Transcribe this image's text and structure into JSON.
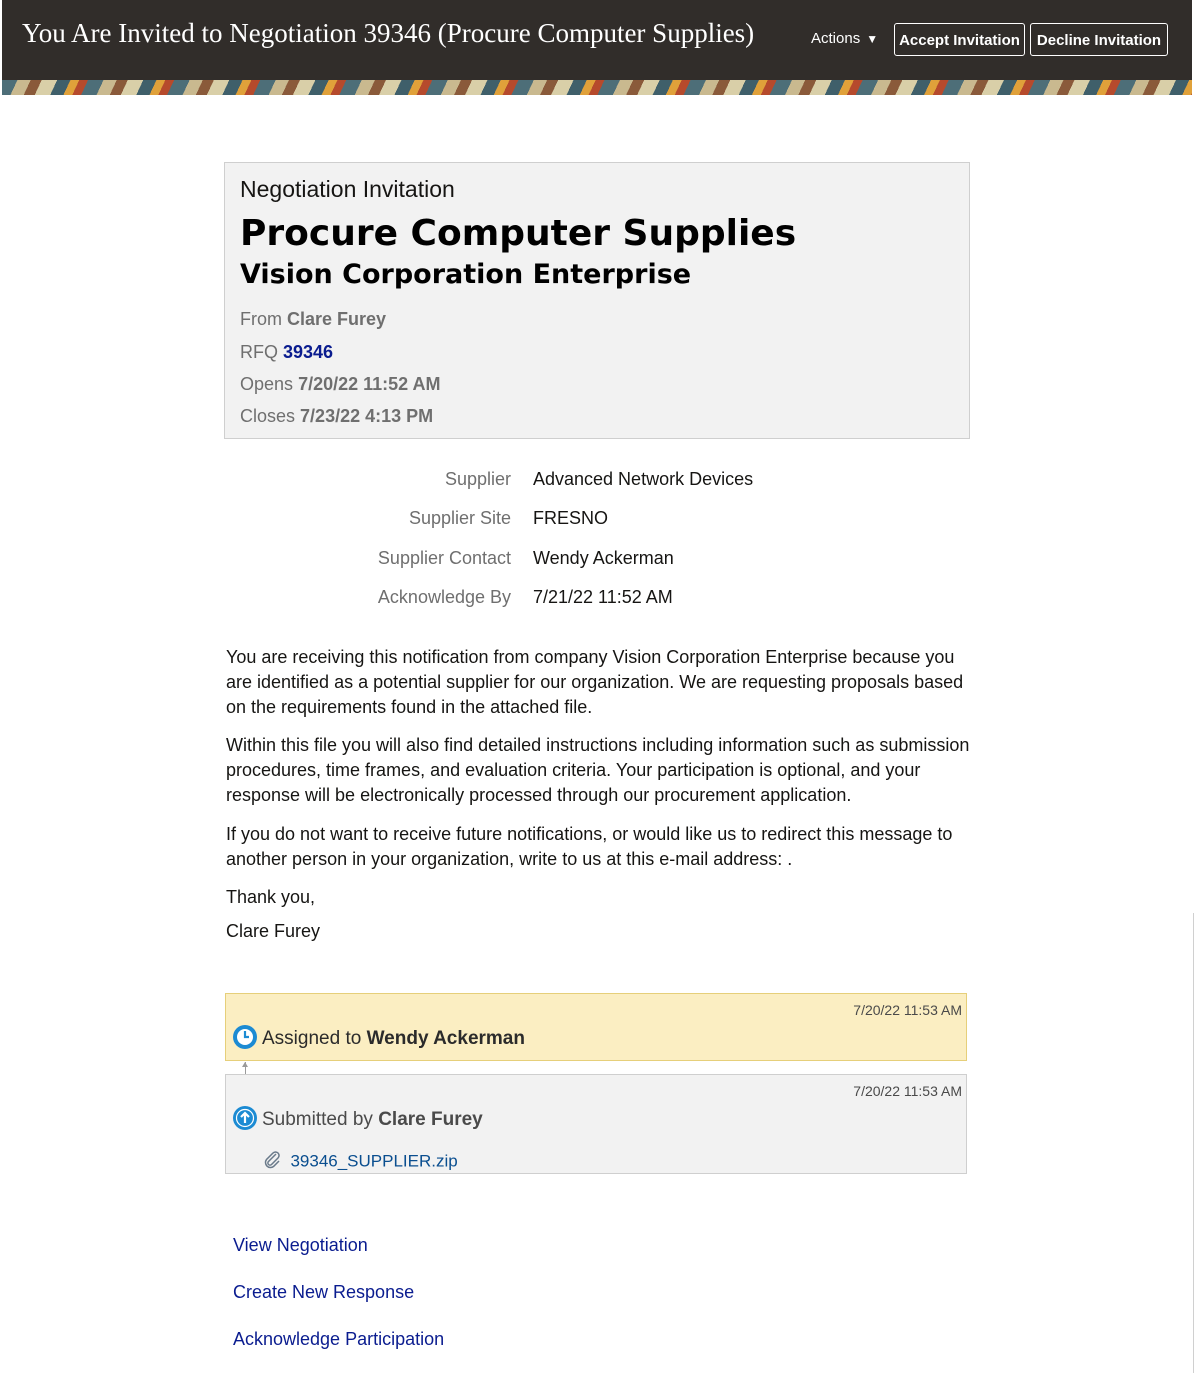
{
  "header": {
    "title": "You Are Invited to Negotiation 39346 (Procure Computer Supplies)",
    "actions_label": "Actions",
    "accept_label": "Accept Invitation",
    "decline_label": "Decline Invitation",
    "background_color": "#312d2a"
  },
  "card": {
    "kicker": "Negotiation Invitation",
    "title": "Procure Computer Supplies",
    "organization": "Vision Corporation Enterprise",
    "from_label": "From",
    "from_value": "Clare Furey",
    "rfq_label": "RFQ",
    "rfq_value": "39346",
    "opens_label": "Opens",
    "opens_value": "7/20/22 11:52 AM",
    "closes_label": "Closes",
    "closes_value": "7/23/22 4:13 PM"
  },
  "details": [
    {
      "label": "Supplier",
      "value": "Advanced Network Devices"
    },
    {
      "label": "Supplier Site",
      "value": "FRESNO"
    },
    {
      "label": "Supplier Contact",
      "value": "Wendy Ackerman"
    },
    {
      "label": "Acknowledge By",
      "value": "7/21/22 11:52 AM"
    }
  ],
  "message": {
    "p1": "You are receiving this notification from company Vision Corporation Enterprise because you are identified as a potential supplier for our organization. We are requesting proposals based on the requirements found in the attached file.",
    "p2": "Within this file you will also find detailed instructions including information such as submission procedures, time frames, and evaluation criteria. Your participation is optional, and your response will be electronically processed through our procurement application.",
    "p3": "If you do not want to receive future notifications, or would like us to redirect this message to another person in your organization, write to us at this e-mail address: .",
    "closing": "Thank you,",
    "signature": "Clare Furey"
  },
  "history": {
    "assigned": {
      "timestamp": "7/20/22 11:53 AM",
      "prefix": "Assigned to",
      "person": "Wendy Ackerman",
      "icon": "clock-icon",
      "color": "#fbeec2"
    },
    "submitted": {
      "timestamp": "7/20/22 11:53 AM",
      "prefix": "Submitted by",
      "person": "Clare Furey",
      "icon": "arrow-up-icon",
      "attachment": "39346_SUPPLIER.zip"
    }
  },
  "links": {
    "view_negotiation": "View Negotiation",
    "create_response": "Create New Response",
    "acknowledge": "Acknowledge Participation",
    "link_color": "#0a1c8f"
  }
}
